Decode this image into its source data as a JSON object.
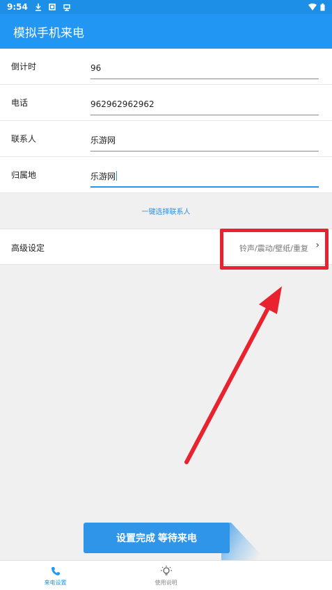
{
  "status_bar": {
    "time": "9:54",
    "icons_left": [
      "download-icon",
      "screenshot-icon",
      "notification-icon"
    ],
    "icons_right": [
      "wifi-icon",
      "battery-icon"
    ]
  },
  "app": {
    "title": "模拟手机来电",
    "primary_color": "#2196f3"
  },
  "form": {
    "fields": [
      {
        "label": "倒计时",
        "value": "96"
      },
      {
        "label": "电话",
        "value": "962962962962"
      },
      {
        "label": "联系人",
        "value": "乐游网"
      },
      {
        "label": "归属地",
        "value": "乐游网"
      }
    ]
  },
  "select_contact": "一键选择联系人",
  "advanced": {
    "label": "高级设定",
    "value": "铃声/震动/壁纸/重复",
    "chevron": "›"
  },
  "annotation": {
    "color": "#e8222e"
  },
  "submit_label": "设置完成 等待来电",
  "bottom_nav": [
    {
      "label": "来电设置",
      "icon": "phone-icon",
      "active": true
    },
    {
      "label": "使用说明",
      "icon": "lightbulb-icon",
      "active": false
    }
  ]
}
